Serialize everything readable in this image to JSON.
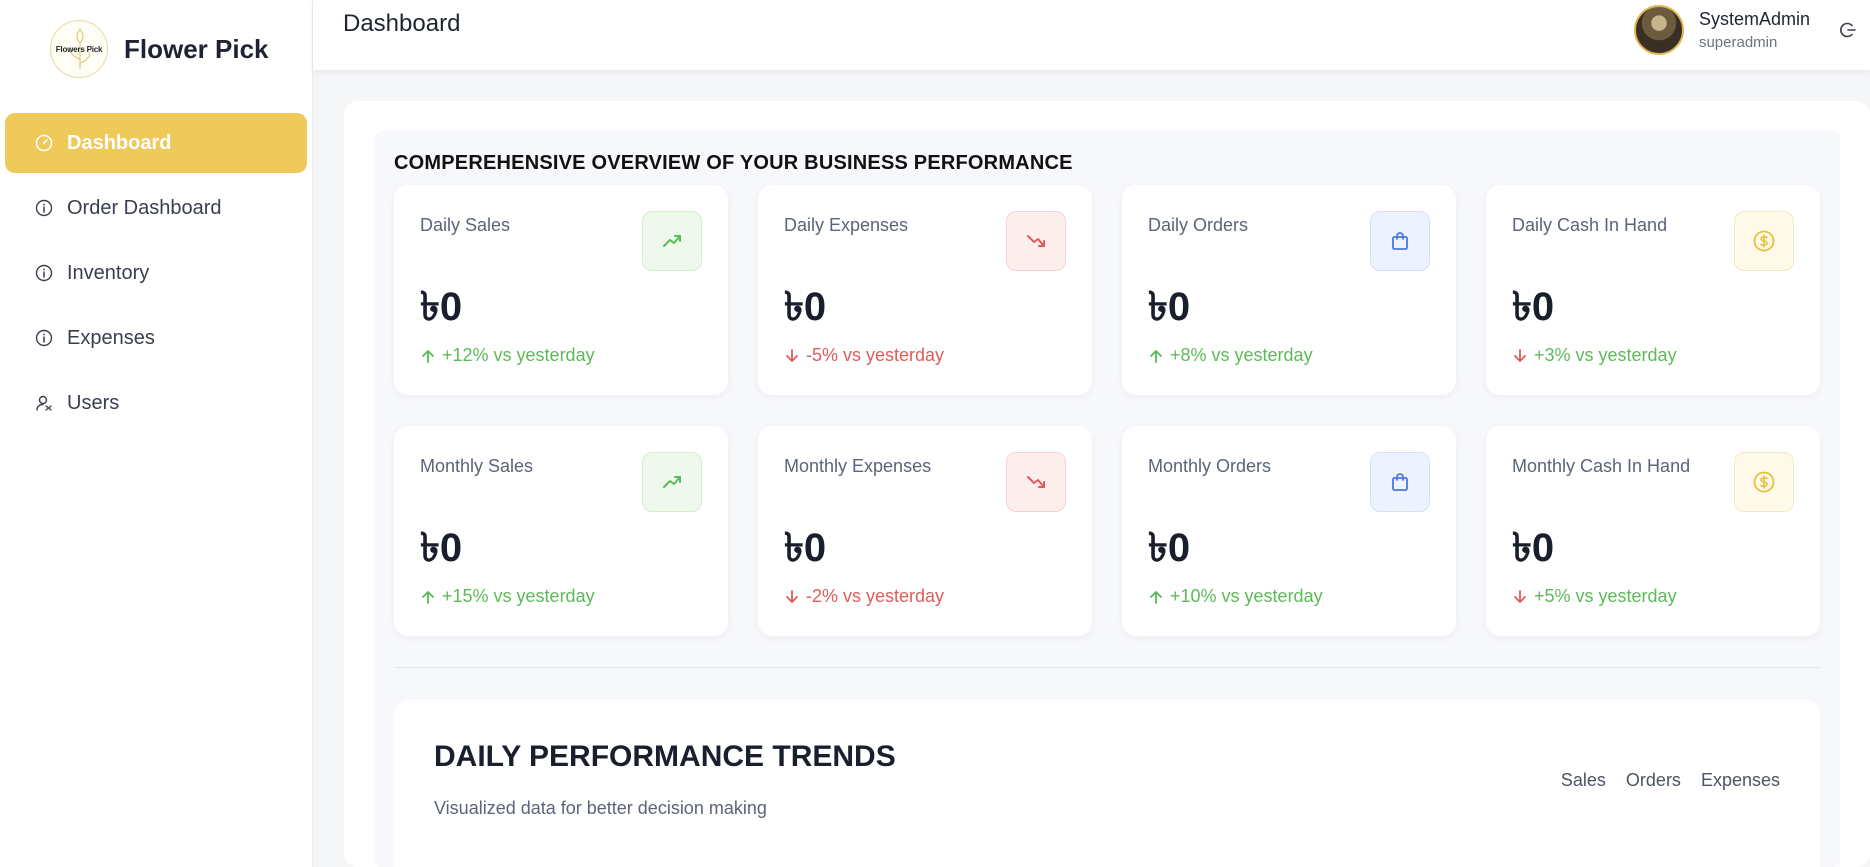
{
  "brand": {
    "name": "Flower Pick",
    "logo_text": "Flowers Pick"
  },
  "sidebar": {
    "items": [
      {
        "label": "Dashboard",
        "icon": "gauge-icon",
        "active": true
      },
      {
        "label": "Order Dashboard",
        "icon": "info-icon"
      },
      {
        "label": "Inventory",
        "icon": "info-icon"
      },
      {
        "label": "Expenses",
        "icon": "info-icon"
      },
      {
        "label": "Users",
        "icon": "users-icon"
      }
    ]
  },
  "header": {
    "title": "Dashboard",
    "user": {
      "name": "SystemAdmin",
      "role": "superadmin"
    }
  },
  "overview": {
    "heading": "COMPEREHENSIVE OVERVIEW OF YOUR BUSINESS PERFORMANCE",
    "cards": [
      {
        "label": "Daily Sales",
        "value": "৳0",
        "change": "+12% vs yesterday",
        "icon": "trend-up-icon"
      },
      {
        "label": "Daily Expenses",
        "value": "৳0",
        "change": "-5% vs yesterday",
        "icon": "trend-down-icon"
      },
      {
        "label": "Daily Orders",
        "value": "৳0",
        "change": "+8% vs yesterday",
        "icon": "shopping-bag-icon"
      },
      {
        "label": "Daily Cash In Hand",
        "value": "৳0",
        "change": "+3% vs yesterday",
        "icon": "dollar-circle-icon"
      },
      {
        "label": "Monthly Sales",
        "value": "৳0",
        "change": "+15% vs yesterday",
        "icon": "trend-up-icon"
      },
      {
        "label": "Monthly Expenses",
        "value": "৳0",
        "change": "-2% vs yesterday",
        "icon": "trend-down-icon"
      },
      {
        "label": "Monthly Orders",
        "value": "৳0",
        "change": "+10% vs yesterday",
        "icon": "shopping-bag-icon"
      },
      {
        "label": "Monthly Cash In Hand",
        "value": "৳0",
        "change": "+5% vs yesterday",
        "icon": "dollar-circle-icon"
      }
    ]
  },
  "trends": {
    "title": "DAILY PERFORMANCE TRENDS",
    "subtitle": "Visualized data for better decision making",
    "tabs": [
      "Sales",
      "Orders",
      "Expenses"
    ]
  },
  "colors": {
    "accent": "#efc95a",
    "positive": "#5dba58",
    "negative": "#e05b5b",
    "blue": "#4a78e0"
  }
}
